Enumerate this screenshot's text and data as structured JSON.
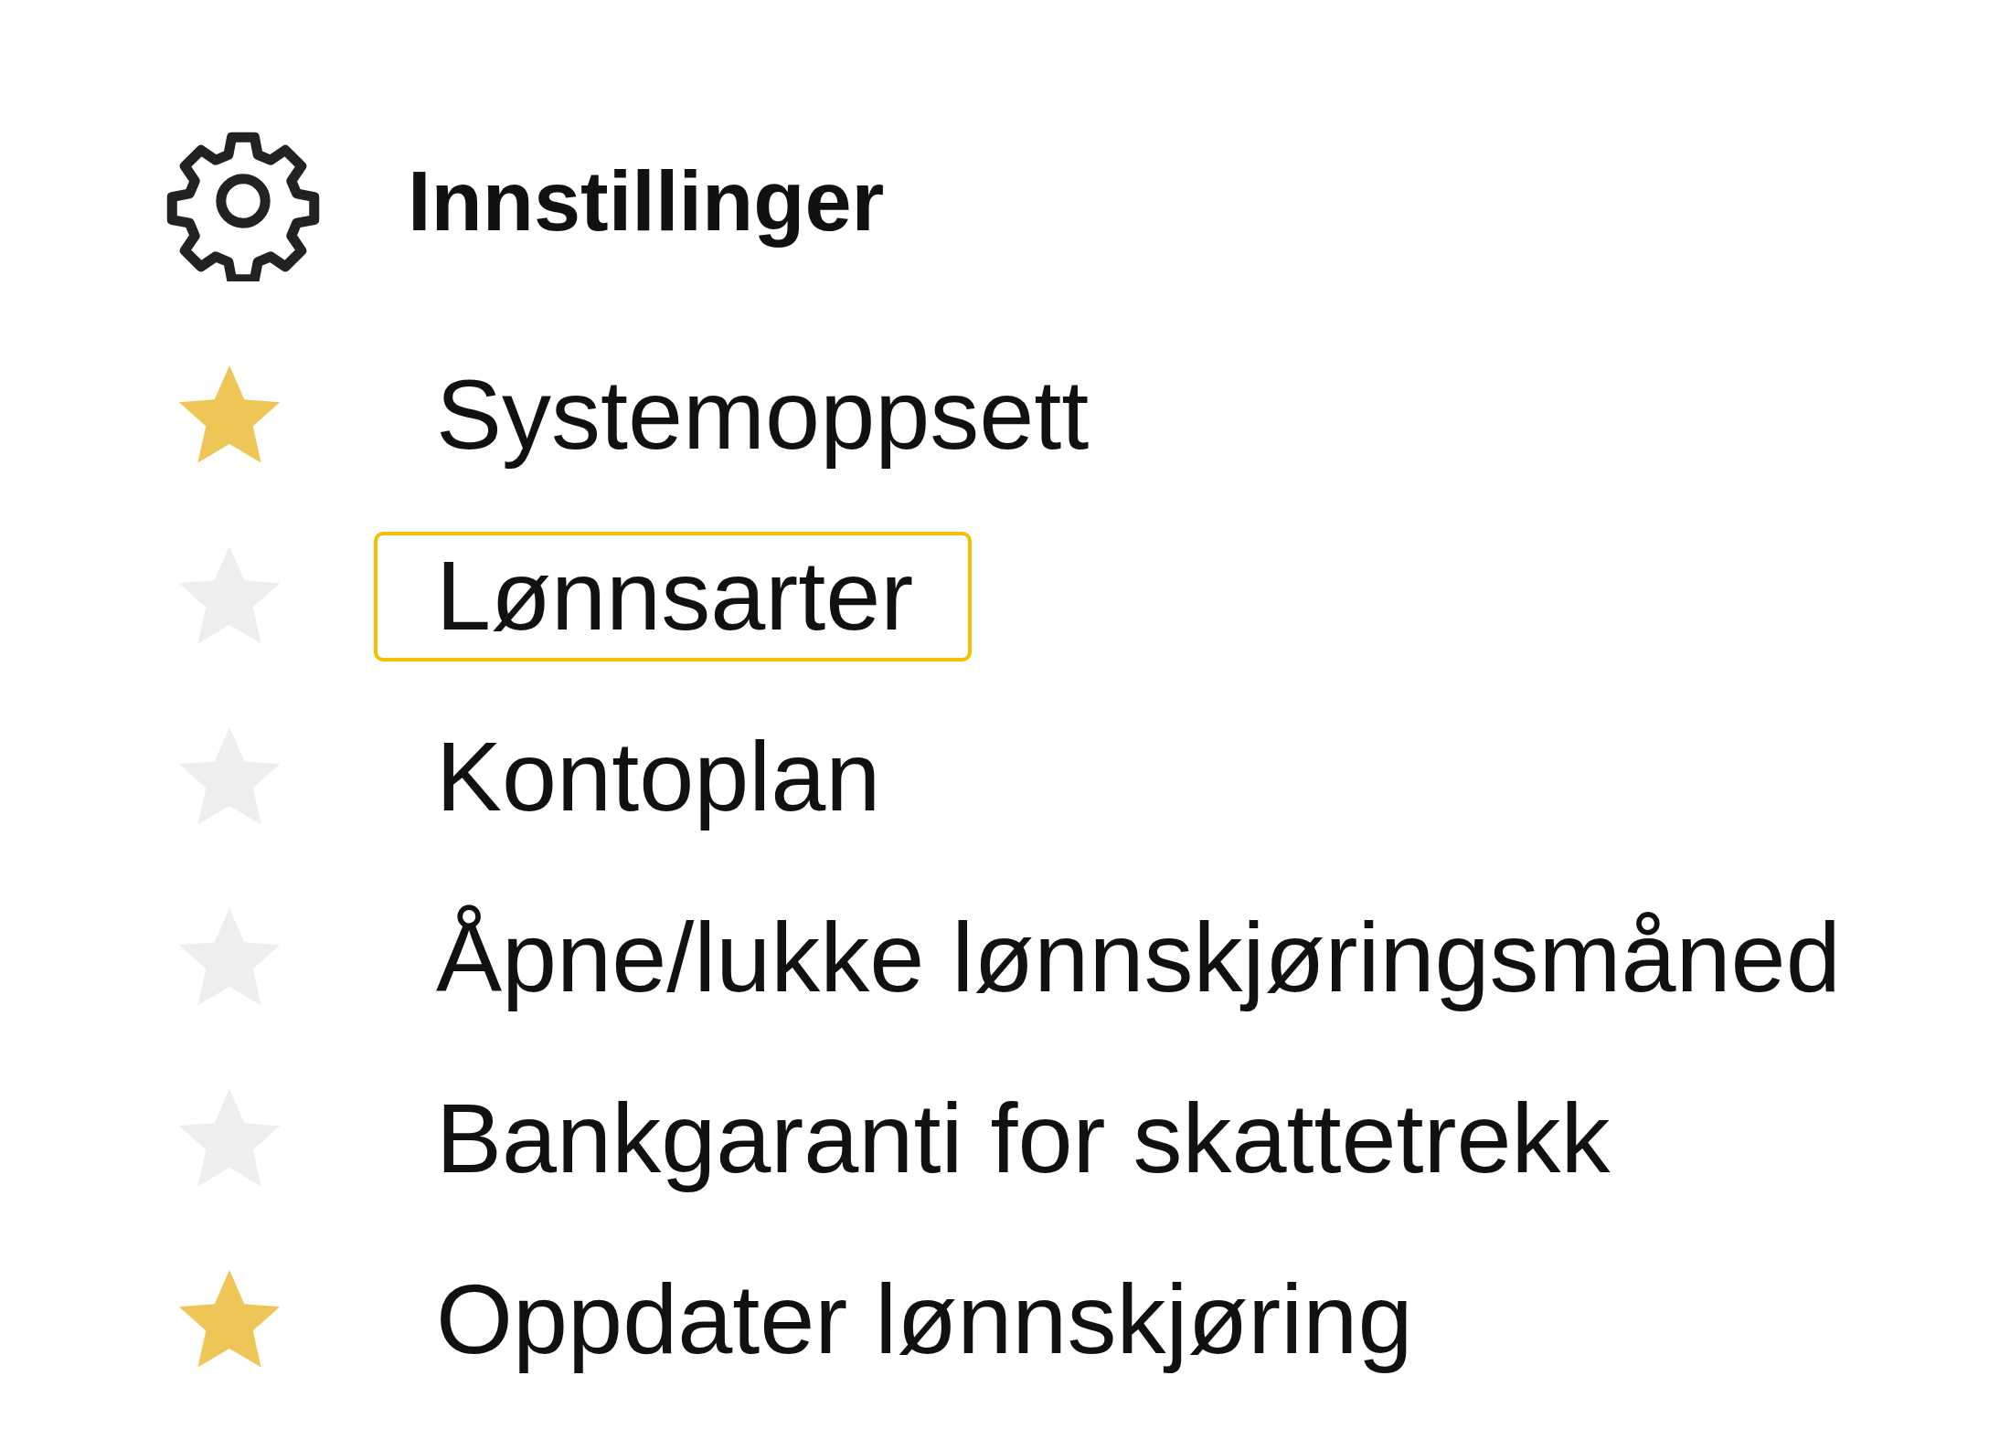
{
  "header": {
    "title": "Innstillinger"
  },
  "items": [
    {
      "label": "Systemoppsett",
      "starred": true,
      "selected": false
    },
    {
      "label": "Lønnsarter",
      "starred": false,
      "selected": true
    },
    {
      "label": "Kontoplan",
      "starred": false,
      "selected": false
    },
    {
      "label": "Åpne/lukke lønnskjøringsmåned",
      "starred": false,
      "selected": false
    },
    {
      "label": "Bankgaranti for skattetrekk",
      "starred": false,
      "selected": false
    },
    {
      "label": "Oppdater lønnskjøring",
      "starred": true,
      "selected": false
    }
  ]
}
